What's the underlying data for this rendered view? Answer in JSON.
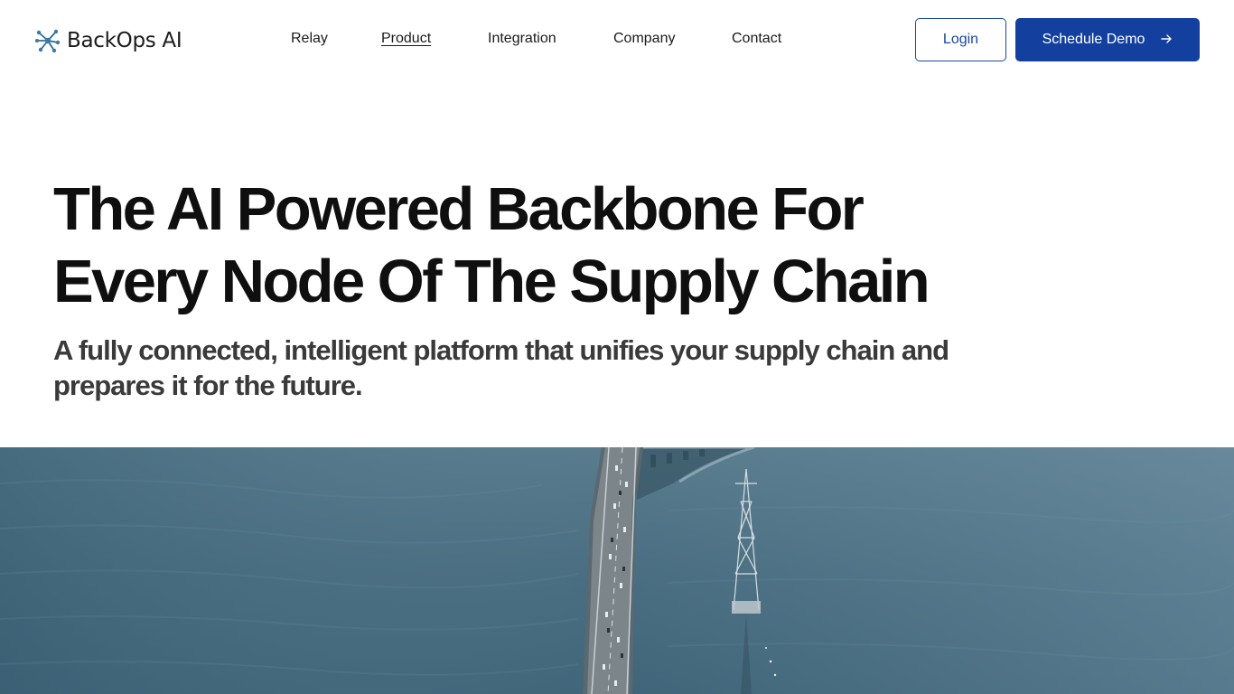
{
  "brand": {
    "name": "BackOps AI",
    "logo_icon": "network-node-icon",
    "color": "#2f5f8a"
  },
  "nav": {
    "items": [
      {
        "label": "Relay",
        "active": false
      },
      {
        "label": "Product",
        "active": true
      },
      {
        "label": "Integration",
        "active": false
      },
      {
        "label": "Company",
        "active": false
      },
      {
        "label": "Contact",
        "active": false
      }
    ]
  },
  "actions": {
    "login_label": "Login",
    "demo_label": "Schedule Demo",
    "demo_icon": "arrow-right-icon",
    "accent_color": "#13409f"
  },
  "hero": {
    "title_line1": "The AI Powered Backbone For",
    "title_line2": "Every Node Of The Supply Chain",
    "subtitle_line1": "A fully connected, intelligent platform that unifies your supply chain and",
    "subtitle_line2": "prepares it for the future.",
    "image": "aerial-bridge-over-water-image"
  }
}
